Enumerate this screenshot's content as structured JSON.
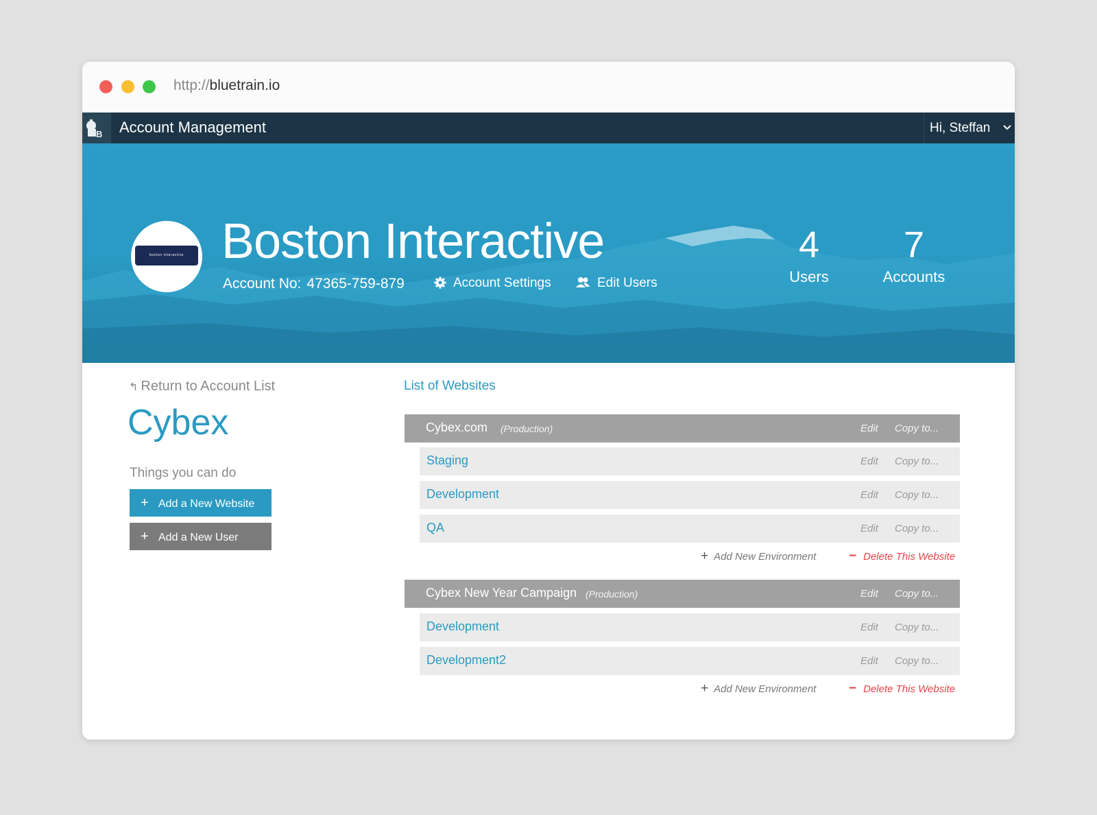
{
  "browser": {
    "url_protocol": "http://",
    "url_domain": "bluetrain.io"
  },
  "navbar": {
    "title": "Account Management",
    "user_greeting": "Hi, Steffan"
  },
  "header": {
    "logo_text": "boston interactive",
    "company_name": "Boston Interactive",
    "account_label": "Account No:",
    "account_number": "47365-759-879",
    "account_settings": "Account Settings",
    "edit_users": "Edit Users",
    "stats": [
      {
        "value": "4",
        "label": "Users"
      },
      {
        "value": "7",
        "label": "Accounts"
      }
    ]
  },
  "sidebar": {
    "return_link": "Return to Account List",
    "site_name": "Cybex",
    "things_heading": "Things you can do",
    "add_website": "Add a New Website",
    "add_user": "Add a New User"
  },
  "main": {
    "heading": "List of Websites",
    "edit_label": "Edit",
    "copy_label": "Copy to...",
    "add_env_label": "Add New Environment",
    "delete_label": "Delete This Website",
    "websites": [
      {
        "name": "Cybex.com",
        "tag": "(Production)",
        "environments": [
          "Staging",
          "Development",
          "QA"
        ]
      },
      {
        "name": "Cybex New Year Campaign",
        "tag": "(Production)",
        "environments": [
          "Development",
          "Development2"
        ]
      }
    ]
  },
  "colors": {
    "accent": "#2a9ac3",
    "navbar": "#1c3445",
    "site_row": "#a1a1a1",
    "env_row": "#ebebeb",
    "danger": "#e8424a"
  },
  "icons": [
    "bluetrain-logo-icon",
    "chevron-down-icon",
    "gear-icon",
    "users-icon",
    "return-arrow-icon",
    "plus-icon",
    "minus-icon"
  ]
}
